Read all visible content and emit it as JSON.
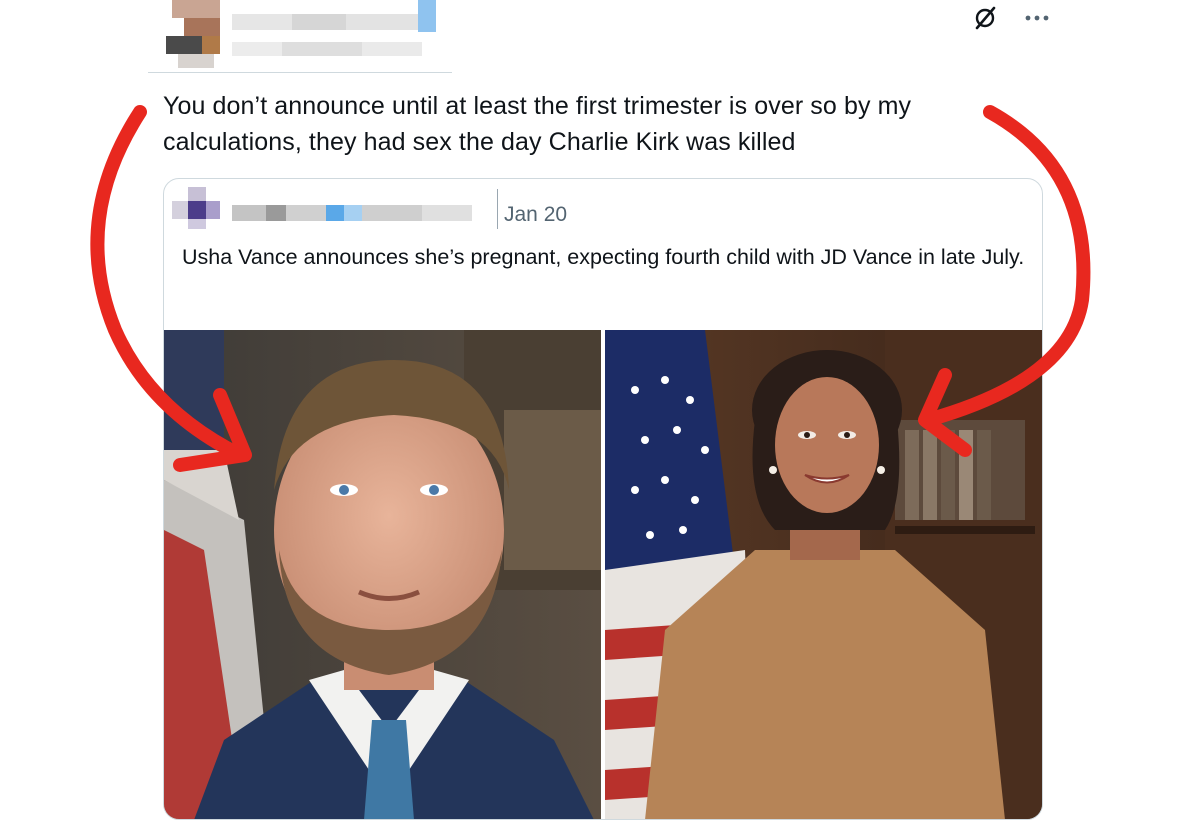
{
  "tweet": {
    "text": "You don’t announce until at least the first trimester is over so by my calculations, they had sex the day Charlie Kirk was killed",
    "grok_icon": "grok-icon",
    "more_icon": "more-dots-icon"
  },
  "quote": {
    "date": "Jan 20",
    "text": "Usha Vance announces she’s pregnant, expecting fourth child with JD Vance in late July.",
    "photos": [
      {
        "icon": "man-portrait-photo"
      },
      {
        "icon": "woman-portrait-photo"
      }
    ]
  },
  "colors": {
    "arrow": "#e8281f",
    "border": "#cfd9de",
    "muted_text": "#536471",
    "text": "#0f1419"
  }
}
